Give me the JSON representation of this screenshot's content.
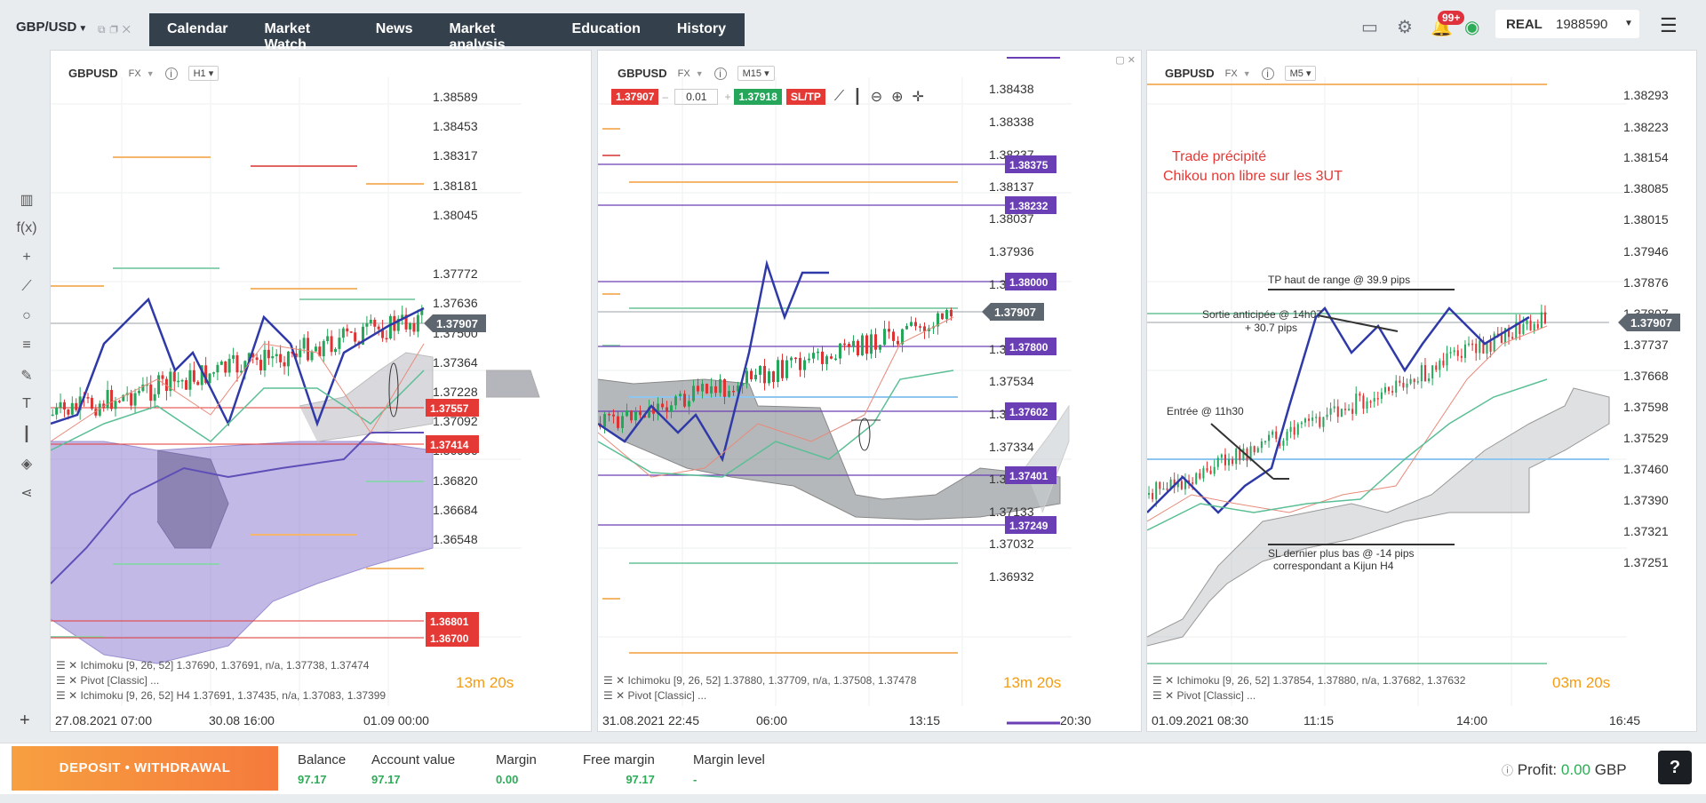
{
  "symbol": "GBP/USD",
  "menu": [
    "Calendar",
    "Market Watch",
    "News",
    "Market analysis",
    "Education",
    "History"
  ],
  "notifications_badge": "99+",
  "account": {
    "type": "REAL",
    "id": "1988590"
  },
  "charts": [
    {
      "instrument": "GBPUSD",
      "asset_class": "FX",
      "timeframe": "H1",
      "price_scale": [
        "1.38589",
        "1.38453",
        "1.38317",
        "1.38181",
        "1.38045",
        "1.37772",
        "1.37636",
        "1.37500",
        "1.37364",
        "1.37228",
        "1.37092",
        "1.36956",
        "1.36820",
        "1.36684",
        "1.36548"
      ],
      "current_price": "1.37907",
      "level_labels": [
        {
          "value": "1.37557",
          "color": "#e53935"
        },
        {
          "value": "1.37414",
          "color": "#e53935"
        },
        {
          "value": "1.36801",
          "color": "#e53935"
        },
        {
          "value": "1.36700",
          "color": "#e53935"
        }
      ],
      "indicators": [
        "Ichimoku [9, 26, 52] 1.37690, 1.37691, n/a, 1.37738, 1.37474",
        "Pivot [Classic] ...",
        "Ichimoku [9, 26, 52] H4 1.37691, 1.37435, n/a, 1.37083, 1.37399"
      ],
      "timer": {
        "minutes": "13",
        "m_unit": "m",
        "seconds": "20",
        "s_unit": "s"
      },
      "time_axis": [
        "27.08.2021 07:00",
        "30.08 16:00",
        "01.09 00:00"
      ]
    },
    {
      "instrument": "GBPUSD",
      "asset_class": "FX",
      "timeframe": "M15",
      "trade": {
        "sell": "1.37907",
        "amount": "0.01",
        "buy": "1.37918",
        "sltp": "SL/TP",
        "minus": "–",
        "plus": "+"
      },
      "price_scale": [
        "1.38438",
        "1.38338",
        "1.38237",
        "1.38137",
        "1.38037",
        "1.37936",
        "1.37836",
        "1.37735",
        "1.37635",
        "1.37534",
        "1.37434",
        "1.37334",
        "1.37233",
        "1.37133",
        "1.37032",
        "1.36932"
      ],
      "current_price": "1.37907",
      "level_labels": [
        {
          "value": "1.38375",
          "color": "#6a3fb5"
        },
        {
          "value": "1.38232",
          "color": "#6a3fb5"
        },
        {
          "value": "1.38000",
          "color": "#6a3fb5"
        },
        {
          "value": "1.37800",
          "color": "#6a3fb5"
        },
        {
          "value": "1.37602",
          "color": "#6a3fb5"
        },
        {
          "value": "1.37401",
          "color": "#6a3fb5"
        },
        {
          "value": "1.37249",
          "color": "#6a3fb5"
        }
      ],
      "indicators": [
        "Ichimoku [9, 26, 52] 1.37880, 1.37709, n/a, 1.37508, 1.37478",
        "Pivot [Classic] ..."
      ],
      "timer": {
        "minutes": "13",
        "m_unit": "m",
        "seconds": "20",
        "s_unit": "s"
      },
      "time_axis": [
        "31.08.2021 22:45",
        "06:00",
        "13:15",
        "20:30"
      ]
    },
    {
      "instrument": "GBPUSD",
      "asset_class": "FX",
      "timeframe": "M5",
      "price_scale": [
        "1.38293",
        "1.38223",
        "1.38154",
        "1.38085",
        "1.38015",
        "1.37946",
        "1.37876",
        "1.37807",
        "1.37737",
        "1.37668",
        "1.37598",
        "1.37529",
        "1.37460",
        "1.37390",
        "1.37321",
        "1.37251"
      ],
      "current_price": "1.37907",
      "annotations": {
        "title_line1": "Trade précipité",
        "title_line2": "Chikou non libre sur les 3UT",
        "tp": "TP haut de range @ 39.9 pips",
        "exit_line1": "Sortie anticipée @ 14h07",
        "exit_line2": "+ 30.7 pips",
        "entry": "Entrée @ 11h30",
        "sl_line1": "SL dernier plus bas @ -14 pips",
        "sl_line2": "correspondant a Kijun H4"
      },
      "indicators": [
        "Ichimoku [9, 26, 52] 1.37854, 1.37880, n/a, 1.37682, 1.37632",
        "Pivot [Classic] ..."
      ],
      "timer": {
        "minutes": "03",
        "m_unit": "m",
        "seconds": "20",
        "s_unit": "s"
      },
      "time_axis": [
        "01.09.2021 08:30",
        "11:15",
        "14:00",
        "16:45"
      ]
    }
  ],
  "bottom": {
    "deposit_label": "DEPOSIT • WITHDRAWAL",
    "stats": [
      {
        "label": "Balance",
        "value": "97.17"
      },
      {
        "label": "Account value",
        "value": "97.17"
      },
      {
        "label": "Margin",
        "value": "0.00"
      },
      {
        "label": "Free margin",
        "value": "97.17"
      },
      {
        "label": "Margin level",
        "value": "-"
      }
    ],
    "profit_label": "Profit:",
    "profit_value": "0.00",
    "profit_currency": "GBP",
    "help": "?"
  },
  "colors": {
    "menu_bg": "#34414c",
    "up": "#26a65b",
    "down": "#e53935",
    "accent": "#f57a3c",
    "level": "#6a3fb5"
  }
}
